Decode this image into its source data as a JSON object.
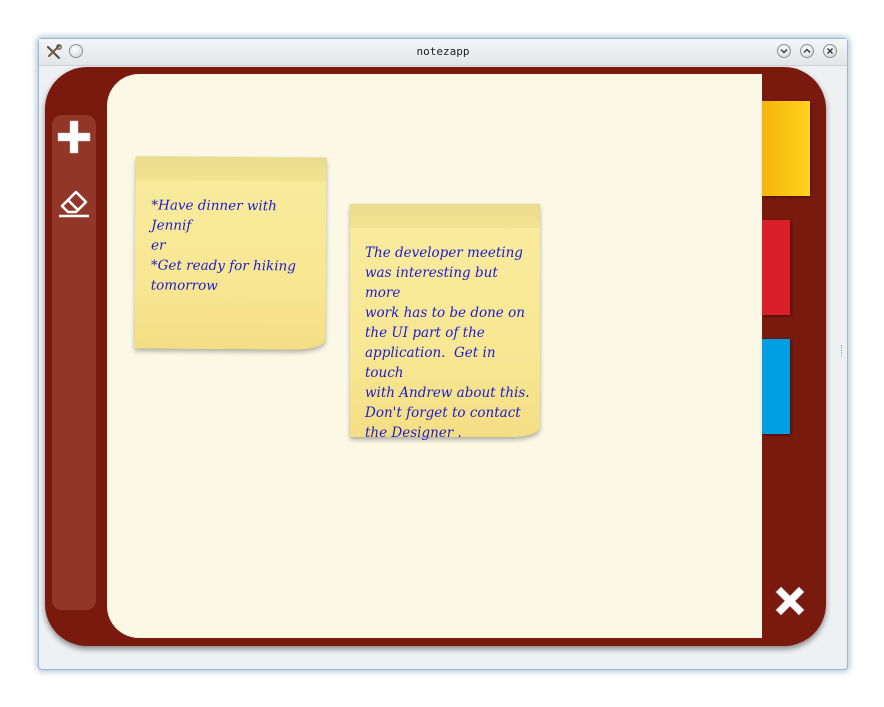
{
  "window": {
    "title": "notezapp",
    "icons": {
      "app": "tools-icon",
      "menu": "window-menu-icon",
      "minimize": "chevron-down-icon",
      "maximize": "chevron-up-icon",
      "close": "close-icon"
    }
  },
  "toolbar": {
    "items": [
      {
        "icon": "plus-icon",
        "action": "add-note"
      },
      {
        "icon": "eraser-icon",
        "action": "erase-note"
      }
    ]
  },
  "notes": [
    {
      "text": "*Have dinner with Jennif\ner\n*Get ready for hiking\ntomorrow"
    },
    {
      "text": "The developer meeting\nwas interesting but more\nwork has to be done on\nthe UI part of the\napplication.  Get in touch\nwith Andrew about this.\nDon't forget to contact\nthe Designer ."
    }
  ],
  "color_tabs": [
    {
      "name": "yellow",
      "color": "#ffc20e"
    },
    {
      "name": "red",
      "color": "#d9202a"
    },
    {
      "name": "blue",
      "color": "#009fe3"
    }
  ],
  "colors": {
    "frame": "#7a1a0f",
    "toolbar": "#93362a",
    "canvas": "#fbf9e6",
    "note": "#f8e894",
    "note_text": "#1c1ccf"
  },
  "close_app_icon": "close-x-icon"
}
